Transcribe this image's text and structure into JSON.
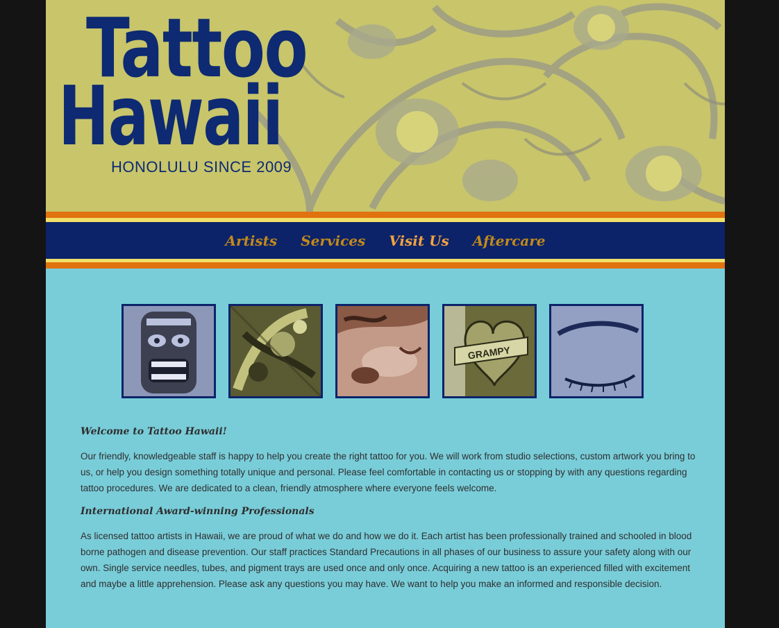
{
  "header": {
    "logo_line1": "Tattoo",
    "logo_line2": "Hawaii",
    "tagline": "HONOLULU SINCE 2009"
  },
  "nav": {
    "items": [
      {
        "label": "Artists"
      },
      {
        "label": "Services"
      },
      {
        "label": "Visit Us"
      },
      {
        "label": "Aftercare"
      }
    ],
    "active": "Visit Us"
  },
  "gallery": {
    "thumbnails": [
      {
        "icon": "tiki-mask-tattoo"
      },
      {
        "icon": "dragon-tattoo"
      },
      {
        "icon": "koi-fish-tattoo"
      },
      {
        "icon": "grampy-heart-banner-tattoo"
      },
      {
        "icon": "eyeliner-cosmetic-tattoo"
      }
    ]
  },
  "content": {
    "welcome_heading": "Welcome to Tattoo Hawaii!",
    "welcome_text": "Our friendly, knowledgeable staff is happy to help you create the right tattoo for you. We will work from studio selections, custom artwork you bring to us, or help you design something totally unique and personal. Please feel comfortable in contacting us or stopping by with any questions regarding tattoo procedures. We are dedicated to a clean, friendly atmosphere where everyone feels welcome.",
    "professionals_heading": "International Award-winning Professionals",
    "professionals_text": "As licensed tattoo artists in Hawaii, we are proud of what we do and how we do it. Each artist has been professionally trained and schooled in blood borne pathogen and disease prevention. Our staff practices Standard Precautions in all phases of our business to assure your safety along with our own. Single service needles, tubes, and pigment trays are used once and only once. Acquiring a new tattoo is an experienced filled with excitement and maybe a little apprehension. Please ask any questions you may have. We want to help you make an informed and responsible decision."
  },
  "colors": {
    "navy": "#0c2369",
    "orange": "#e0720f",
    "yellow": "#f0e06a",
    "teal": "#79cdd9",
    "nav_text": "#c28a1a",
    "nav_active": "#f3a340"
  }
}
